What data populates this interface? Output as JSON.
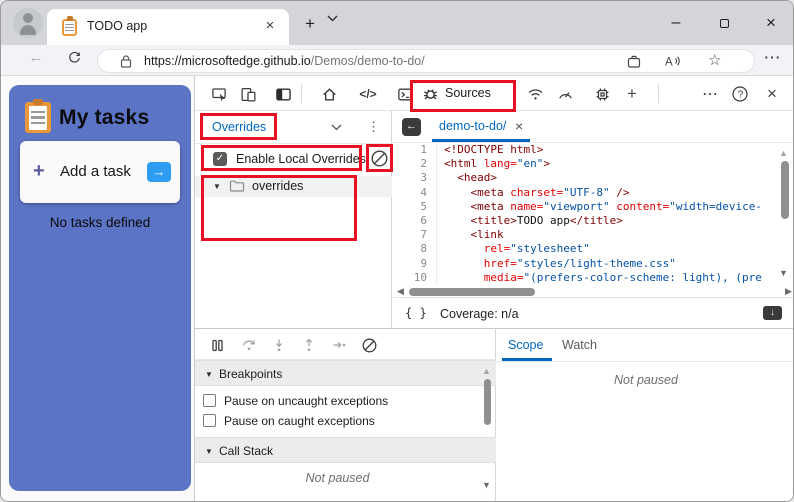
{
  "browser": {
    "tab_title": "TODO app",
    "url_domain": "https://microsoftedge.github.io",
    "url_path": "/Demos/demo-to-do/"
  },
  "page": {
    "title": "My tasks",
    "add_task_label": "Add a task",
    "empty_message": "No tasks defined"
  },
  "devtools": {
    "sources_tab_label": "Sources",
    "navigator": {
      "dropdown_label": "Overrides",
      "enable_overrides_label": "Enable Local Overrides",
      "folder_name": "overrides"
    },
    "editor": {
      "tab_label": "demo-to-do/",
      "code_lines": [
        {
          "num": "1",
          "tokens": [
            {
              "c": "tag",
              "t": "<!DOCTYPE html>"
            }
          ]
        },
        {
          "num": "2",
          "tokens": [
            {
              "c": "tag",
              "t": "<html"
            },
            {
              "c": "attr",
              "t": " lang="
            },
            {
              "c": "str",
              "t": "\"en\""
            },
            {
              "c": "tag",
              "t": ">"
            }
          ]
        },
        {
          "num": "3",
          "tokens": [
            {
              "c": "plain",
              "t": "  "
            },
            {
              "c": "tag",
              "t": "<head>"
            }
          ]
        },
        {
          "num": "4",
          "tokens": [
            {
              "c": "plain",
              "t": "    "
            },
            {
              "c": "tag",
              "t": "<meta"
            },
            {
              "c": "attr",
              "t": " charset="
            },
            {
              "c": "str",
              "t": "\"UTF-8\""
            },
            {
              "c": "tag",
              "t": " />"
            }
          ]
        },
        {
          "num": "5",
          "tokens": [
            {
              "c": "plain",
              "t": "    "
            },
            {
              "c": "tag",
              "t": "<meta"
            },
            {
              "c": "attr",
              "t": " name="
            },
            {
              "c": "str",
              "t": "\"viewport\""
            },
            {
              "c": "attr",
              "t": " content="
            },
            {
              "c": "str",
              "t": "\"width=device-"
            }
          ]
        },
        {
          "num": "6",
          "tokens": [
            {
              "c": "plain",
              "t": "    "
            },
            {
              "c": "tag",
              "t": "<title>"
            },
            {
              "c": "plain",
              "t": "TODO app"
            },
            {
              "c": "tag",
              "t": "</title>"
            }
          ]
        },
        {
          "num": "7",
          "tokens": [
            {
              "c": "plain",
              "t": "    "
            },
            {
              "c": "tag",
              "t": "<link"
            }
          ]
        },
        {
          "num": "8",
          "tokens": [
            {
              "c": "plain",
              "t": "      "
            },
            {
              "c": "attr",
              "t": "rel="
            },
            {
              "c": "str",
              "t": "\"stylesheet\""
            }
          ]
        },
        {
          "num": "9",
          "tokens": [
            {
              "c": "plain",
              "t": "      "
            },
            {
              "c": "attr",
              "t": "href="
            },
            {
              "c": "str",
              "t": "\"styles/light-theme.css\""
            }
          ]
        },
        {
          "num": "10",
          "tokens": [
            {
              "c": "plain",
              "t": "      "
            },
            {
              "c": "attr",
              "t": "media="
            },
            {
              "c": "str",
              "t": "\"(prefers-color-scheme: light), (pre"
            }
          ]
        }
      ]
    },
    "coverage_label": "Coverage: n/a",
    "debugger": {
      "breakpoints_title": "Breakpoints",
      "checkbox_labels": [
        "Pause on uncaught exceptions",
        "Pause on caught exceptions"
      ],
      "call_stack_title": "Call Stack",
      "paused_state": "Not paused"
    },
    "side_pane": {
      "tabs": [
        "Scope",
        "Watch"
      ],
      "message": "Not paused"
    }
  },
  "icons": {
    "close": "×",
    "minimize": "–",
    "new_tab": "+",
    "back_arrow": "←",
    "star": "☆",
    "kebab": "⋮",
    "more_dots": "⋯",
    "caret_down": "▼",
    "scroll_up": "▲",
    "scroll_down": "▼",
    "scroll_left": "◀",
    "scroll_right": "▶",
    "check": "✓",
    "arrow_right": "→",
    "left_arrow": "←",
    "down_arrow": "↓",
    "plus": "+",
    "pretty_print": "{ }",
    "code_tag": "</>"
  },
  "colors": {
    "accent_blue": "#0067c0",
    "annotation_red": "#e81123",
    "app_panel_blue": "#5b74c5",
    "add_button_blue": "#2e9cf0",
    "code_tag": "#800000",
    "code_attr": "#e50000",
    "code_string": "#0451a5",
    "tab_strip_gray": "#d3d5d9"
  }
}
